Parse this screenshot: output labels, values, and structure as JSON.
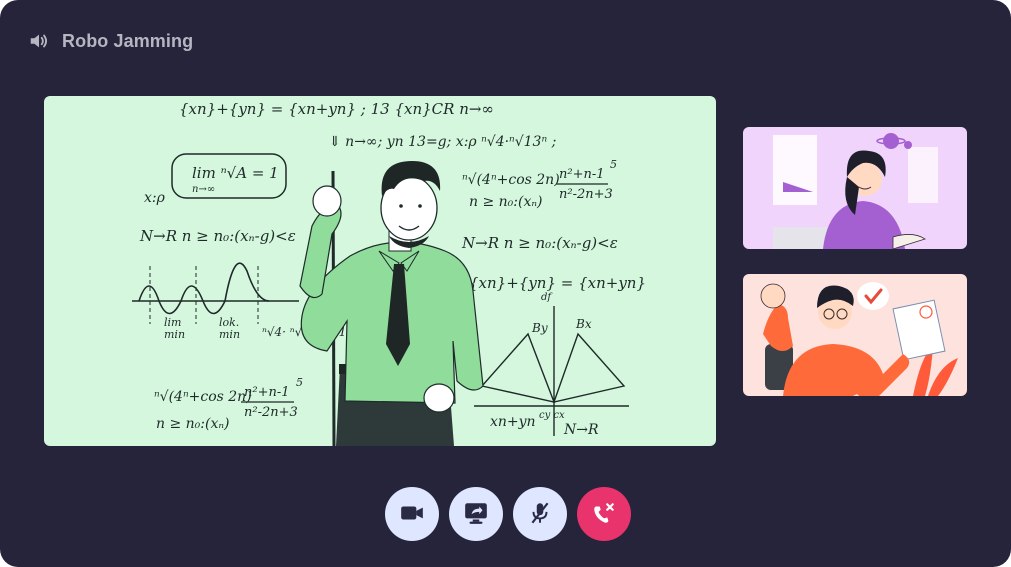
{
  "header": {
    "title": "Robo Jamming",
    "icon": "speaker-icon"
  },
  "main_video": {
    "participant": "teacher",
    "board_text": {
      "row1": "{xn}+{yn} = {xn+yn} ; 13   {xn}CR   n→∞",
      "row2": "⇓ n→∞;   yn   13=g;  x:ρ  ⁿ√4·ⁿ√13ⁿ ;",
      "lim": "lim ⁿ√A = 1",
      "lim_sub": "n→∞",
      "xp": "x:ρ",
      "nr1": "N→R   n ≥ n₀:(xₙ-g)<ε",
      "sqrt_expr": "ⁿ√(4ⁿ+cos 2n)",
      "frac_top": "n²+n-1",
      "frac_bot": "n²-2n+3",
      "exp5": "5",
      "nge": "n ≥ n₀:(xₙ)",
      "nr2": "N→R   n ≥ n₀:(xₙ-g)<ε",
      "sets": "{xn}+{yn} = {xn+yn}",
      "set_sub": "df",
      "wave_lbl1": "lim",
      "wave_lbl1b": "min",
      "wave_lbl2": "lok.",
      "wave_lbl2b": "min",
      "roots": "ⁿ√4· ⁿ√13ⁿ·ⁿ√13ⁿ",
      "by": "By",
      "bx": "Bx",
      "cy_cx": "cy  cx",
      "xy_bottom": "xn+yn",
      "nr3": "N→R",
      "sqrt2": "ⁿ√(4ⁿ+cos 2n)",
      "frac2_top": "n²+n-1",
      "frac2_bot": "n²-2n+3",
      "exp5b": "5",
      "nge2": "n ≥ n₀:(xₙ)"
    }
  },
  "participants": [
    {
      "name": "student-girl",
      "bg": "#f1d4fb"
    },
    {
      "name": "student-boy",
      "bg": "#fde2de"
    }
  ],
  "controls": {
    "camera": "camera-icon",
    "screen_share": "screen-share-icon",
    "mute": "mic-off-icon",
    "end_call": "end-call-icon",
    "end_call_color": "#e8336d",
    "button_color": "#dfe6ff"
  },
  "colors": {
    "window_bg": "#25243a",
    "title": "#b6b6c2",
    "board_bg": "#d4f7dd",
    "shirt": "#8fdc9b"
  }
}
